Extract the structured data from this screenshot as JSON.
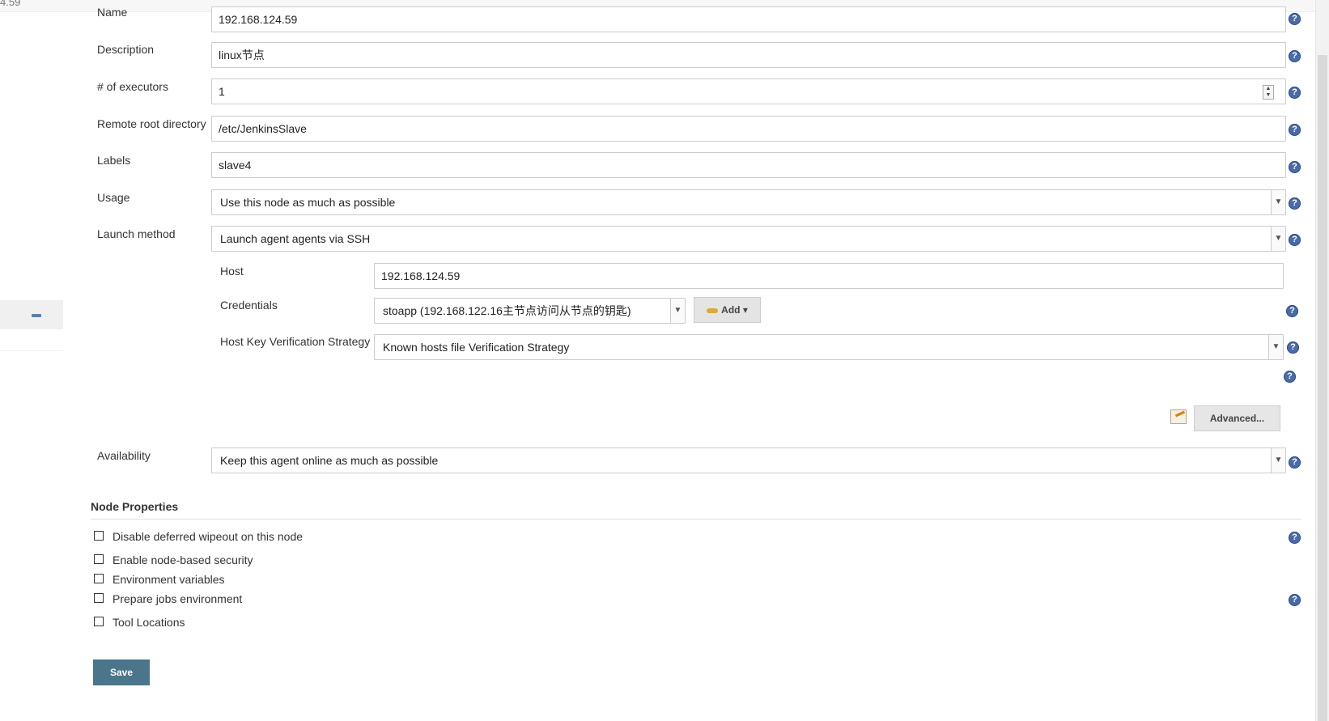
{
  "top_fragment": "4.59",
  "form": {
    "name": {
      "label": "Name",
      "value": "192.168.124.59"
    },
    "description": {
      "label": "Description",
      "value": "linux节点"
    },
    "executors": {
      "label": "# of executors",
      "value": "1"
    },
    "remote_root": {
      "label": "Remote root directory",
      "value": "/etc/JenkinsSlave"
    },
    "labels": {
      "label": "Labels",
      "value": "slave4"
    },
    "usage": {
      "label": "Usage",
      "value": "Use this node as much as possible"
    },
    "launch_method": {
      "label": "Launch method",
      "value": "Launch agent agents via SSH"
    },
    "ssh": {
      "host": {
        "label": "Host",
        "value": "192.168.124.59"
      },
      "credentials": {
        "label": "Credentials",
        "value": "stoapp (192.168.122.16主节点访问从节点的钥匙)",
        "add_label": "Add"
      },
      "host_key": {
        "label": "Host Key Verification Strategy",
        "value": "Known hosts file Verification Strategy"
      },
      "advanced_label": "Advanced..."
    },
    "availability": {
      "label": "Availability",
      "value": "Keep this agent online as much as possible"
    }
  },
  "node_properties": {
    "title": "Node Properties",
    "items": [
      {
        "label": "Disable deferred wipeout on this node",
        "checked": false
      },
      {
        "label": "Enable node-based security",
        "checked": false
      },
      {
        "label": "Environment variables",
        "checked": false
      },
      {
        "label": "Prepare jobs environment",
        "checked": false
      },
      {
        "label": "Tool Locations",
        "checked": false
      }
    ]
  },
  "save_label": "Save",
  "help_glyph": "?",
  "colors": {
    "accent": "#4b758b",
    "help": "#4a6aa8"
  }
}
